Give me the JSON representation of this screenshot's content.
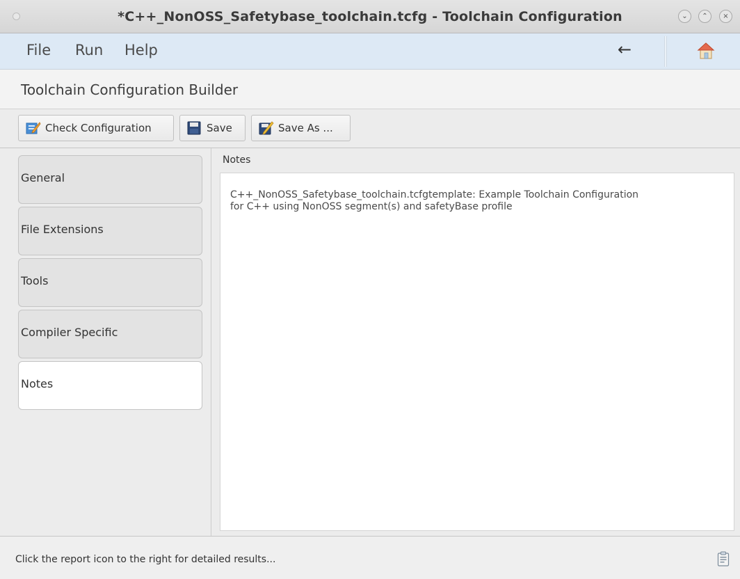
{
  "window": {
    "title": "*C++_NonOSS_Safetybase_toolchain.tcfg - Toolchain Configuration",
    "controls": [
      "minimize",
      "maximize",
      "close"
    ]
  },
  "menubar": {
    "items": [
      "File",
      "Run",
      "Help"
    ],
    "back_icon": "back-arrow-icon",
    "home_icon": "home-icon"
  },
  "builder": {
    "title": "Toolchain Configuration Builder"
  },
  "toolbar": {
    "check_label": "Check Configuration",
    "save_label": "Save",
    "save_as_label": "Save As ..."
  },
  "nav": {
    "tabs": [
      {
        "label": "General",
        "active": false
      },
      {
        "label": "File Extensions",
        "active": false
      },
      {
        "label": "Tools",
        "active": false
      },
      {
        "label": "Compiler Specific",
        "active": false
      },
      {
        "label": "Notes",
        "active": true
      }
    ]
  },
  "notes": {
    "header": "Notes",
    "line1": "C++_NonOSS_Safetybase_toolchain.tcfgtemplate: Example Toolchain Configuration",
    "line2": "for C++ using NonOSS segment(s) and safetyBase profile"
  },
  "status": {
    "text": "Click the report icon to the right for detailed results..."
  },
  "colors": {
    "menubar_bg": "#dde9f5",
    "active_tab_bg": "#ffffff",
    "inactive_tab_bg": "#e3e3e3"
  }
}
